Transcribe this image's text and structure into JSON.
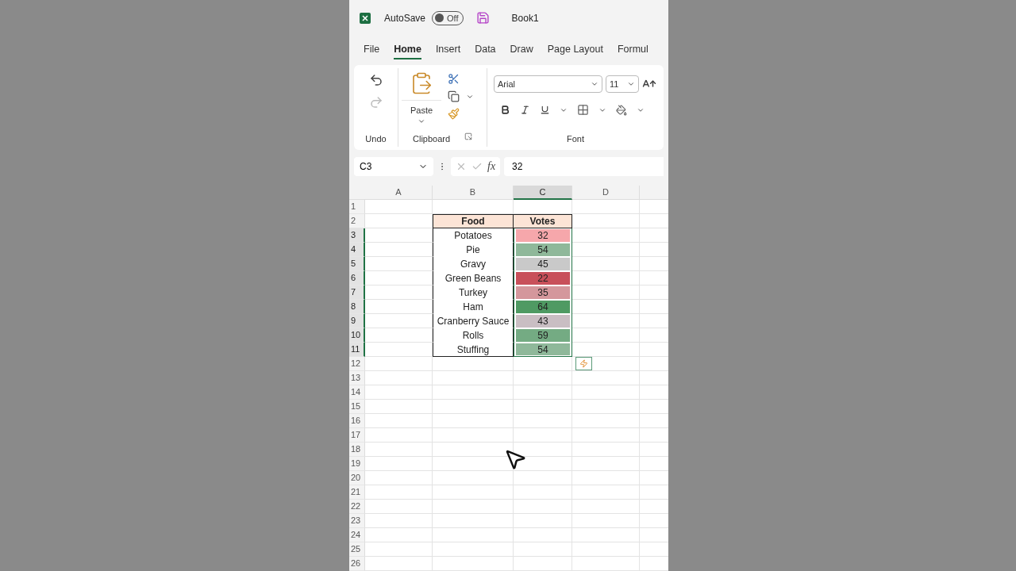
{
  "title_bar": {
    "autosave_label": "AutoSave",
    "autosave_toggle": {
      "on": false,
      "label": "Off"
    },
    "workbook": "Book1"
  },
  "tabs": [
    {
      "label": "File",
      "selected": false
    },
    {
      "label": "Home",
      "selected": true
    },
    {
      "label": "Insert",
      "selected": false
    },
    {
      "label": "Data",
      "selected": false
    },
    {
      "label": "Draw",
      "selected": false
    },
    {
      "label": "Page Layout",
      "selected": false
    },
    {
      "label": "Formul",
      "selected": false
    }
  ],
  "ribbon": {
    "undo_group": "Undo",
    "clipboard_group": "Clipboard",
    "paste_label": "Paste",
    "font_group": "Font",
    "font_name": "Arial",
    "font_size": "11"
  },
  "formula_bar": {
    "name_box": "C3",
    "fx": "fx",
    "value": "32"
  },
  "sheet": {
    "columns": [
      {
        "label": "A",
        "selected": false
      },
      {
        "label": "B",
        "selected": false
      },
      {
        "label": "C",
        "selected": true
      },
      {
        "label": "D",
        "selected": false
      }
    ],
    "row_numbers": [
      {
        "label": "1",
        "selected": false
      },
      {
        "label": "2",
        "selected": false
      },
      {
        "label": "3",
        "selected": true
      },
      {
        "label": "4",
        "selected": true
      },
      {
        "label": "5",
        "selected": true
      },
      {
        "label": "6",
        "selected": true
      },
      {
        "label": "7",
        "selected": true
      },
      {
        "label": "8",
        "selected": true
      },
      {
        "label": "9",
        "selected": true
      },
      {
        "label": "10",
        "selected": true
      },
      {
        "label": "11",
        "selected": true
      },
      {
        "label": "12",
        "selected": false
      },
      {
        "label": "13",
        "selected": false
      },
      {
        "label": "14",
        "selected": false
      },
      {
        "label": "15",
        "selected": false
      },
      {
        "label": "16",
        "selected": false
      },
      {
        "label": "17",
        "selected": false
      },
      {
        "label": "18",
        "selected": false
      },
      {
        "label": "19",
        "selected": false
      },
      {
        "label": "20",
        "selected": false
      },
      {
        "label": "21",
        "selected": false
      },
      {
        "label": "22",
        "selected": false
      },
      {
        "label": "23",
        "selected": false
      },
      {
        "label": "24",
        "selected": false
      },
      {
        "label": "25",
        "selected": false
      },
      {
        "label": "26",
        "selected": false
      }
    ]
  },
  "table": {
    "headers": [
      "Food",
      "Votes"
    ],
    "rows": [
      {
        "food": "Potatoes",
        "votes": "32",
        "color": "#f6a7ab"
      },
      {
        "food": "Pie",
        "votes": "54",
        "color": "#8fb89a"
      },
      {
        "food": "Gravy",
        "votes": "45",
        "color": "#c9c9c9"
      },
      {
        "food": "Green Beans",
        "votes": "22",
        "color": "#c8505a"
      },
      {
        "food": "Turkey",
        "votes": "35",
        "color": "#d4979c"
      },
      {
        "food": "Ham",
        "votes": "64",
        "color": "#4f9a63"
      },
      {
        "food": "Cranberry Sauce",
        "votes": "43",
        "color": "#c9bec3"
      },
      {
        "food": "Rolls",
        "votes": "59",
        "color": "#74ab83"
      },
      {
        "food": "Stuffing",
        "votes": "54",
        "color": "#8fb89a"
      }
    ]
  }
}
